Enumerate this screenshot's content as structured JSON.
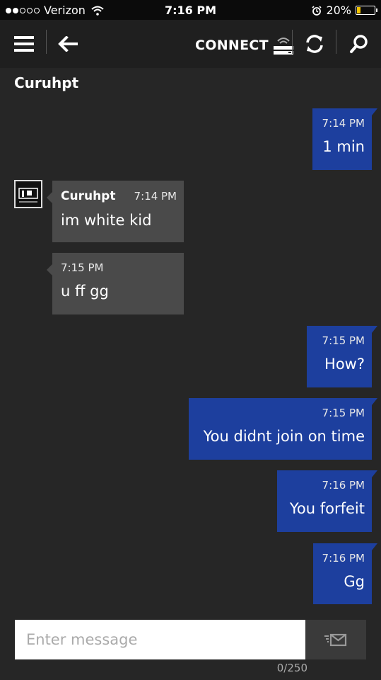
{
  "status_bar": {
    "carrier": "Verizon",
    "time": "7:16 PM",
    "battery_percent": "20%",
    "battery_level": 0.2,
    "signal_dots": [
      true,
      true,
      false,
      false,
      false
    ]
  },
  "app_bar": {
    "menu_icon": "hamburger-icon",
    "back_icon": "back-arrow-icon",
    "connect_label": "CONNECT",
    "refresh_icon": "refresh-icon",
    "search_icon": "search-icon"
  },
  "conversation": {
    "title": "Curuhpt",
    "messages": [
      {
        "direction": "out",
        "time": "7:14 PM",
        "text": "1 min"
      },
      {
        "direction": "in",
        "sender": "Curuhpt",
        "time": "7:14 PM",
        "text": "im white kid"
      },
      {
        "direction": "in",
        "time": "7:15 PM",
        "text": "u ff gg"
      },
      {
        "direction": "out",
        "time": "7:15 PM",
        "text": "How?"
      },
      {
        "direction": "out",
        "time": "7:15 PM",
        "text": "You didnt join on time"
      },
      {
        "direction": "out",
        "time": "7:16 PM",
        "text": "You forfeit"
      },
      {
        "direction": "out",
        "time": "7:16 PM",
        "text": "Gg"
      }
    ]
  },
  "composer": {
    "placeholder": "Enter message",
    "counter": "0/250"
  },
  "colors": {
    "outgoing": "#1d3f9e",
    "incoming": "#4a4a4a",
    "background": "#262626"
  }
}
